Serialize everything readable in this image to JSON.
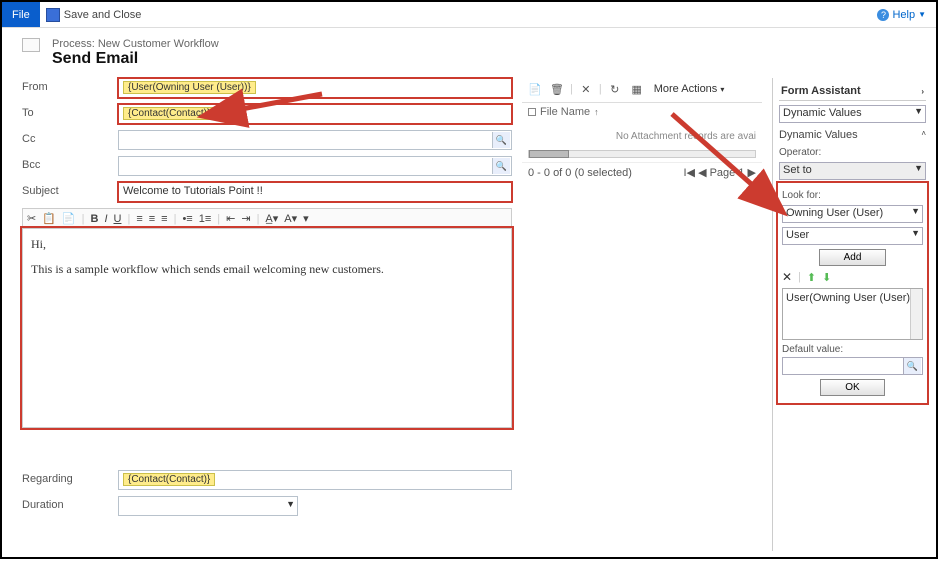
{
  "ribbon": {
    "file": "File",
    "save_close": "Save and Close",
    "help": "Help"
  },
  "header": {
    "process_line": "Process: New Customer Workflow",
    "title": "Send Email"
  },
  "form": {
    "from_label": "From",
    "from_value": "{User(Owning User (User))}",
    "to_label": "To",
    "to_value": "{Contact(Contact)}",
    "cc_label": "Cc",
    "bcc_label": "Bcc",
    "subject_label": "Subject",
    "subject_value": "Welcome to Tutorials Point !!",
    "regarding_label": "Regarding",
    "regarding_value": "{Contact(Contact)}",
    "duration_label": "Duration"
  },
  "editor": {
    "line1": "Hi,",
    "line2": "This is a sample workflow which sends email welcoming new customers."
  },
  "attachments": {
    "more_actions": "More Actions",
    "file_name_col": "File Name",
    "no_attachments": "No Attachment records are avai",
    "selected_text": "0 - 0 of 0 (0 selected)",
    "page_text": "Page 1"
  },
  "assistant": {
    "title": "Form Assistant",
    "dynamic_values": "Dynamic Values",
    "operator_label": "Operator:",
    "operator_value": "Set to",
    "lookfor_label": "Look for:",
    "lookfor_entity": "Owning User (User)",
    "lookfor_attr": "User",
    "add_btn": "Add",
    "list_item": "User(Owning User (User))",
    "default_label": "Default value:",
    "ok_btn": "OK"
  }
}
